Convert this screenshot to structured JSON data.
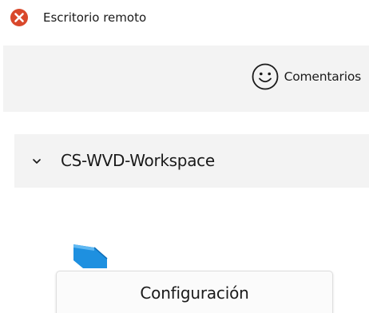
{
  "app": {
    "title": "Escritorio remoto",
    "icon": "remote-desktop-logo",
    "accent_color": "#d9482b"
  },
  "toolbar": {
    "feedback_label": "Comentarios",
    "feedback_icon": "smiley-icon"
  },
  "workspace": {
    "name": "CS-WVD-Workspace",
    "expanded": true,
    "chevron_icon": "chevron-down-icon"
  },
  "resource": {
    "icon": "desktop-icon",
    "color": "#1e90e0"
  },
  "context_menu": {
    "settings_label": "Configuración"
  }
}
